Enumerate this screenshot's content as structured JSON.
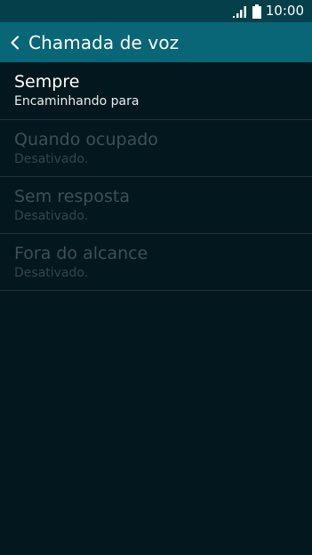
{
  "status_bar": {
    "time": "10:00",
    "signal_icon": "signal-bars-icon",
    "battery_icon": "battery-icon"
  },
  "app_bar": {
    "back_icon": "chevron-left-icon",
    "title": "Chamada de voz"
  },
  "forwarding_options": [
    {
      "title": "Sempre",
      "subtitle": "Encaminhando para",
      "enabled": true
    },
    {
      "title": "Quando ocupado",
      "subtitle": "Desativado.",
      "enabled": false
    },
    {
      "title": "Sem resposta",
      "subtitle": "Desativado.",
      "enabled": false
    },
    {
      "title": "Fora do alcance",
      "subtitle": "Desativado.",
      "enabled": false
    }
  ],
  "colors": {
    "status_bar_bg": "#053f4a",
    "app_bar_bg": "#086677",
    "background": "#03171e",
    "divider": "#263239",
    "text_primary": "#ffffff",
    "text_disabled": "#3c5058"
  }
}
